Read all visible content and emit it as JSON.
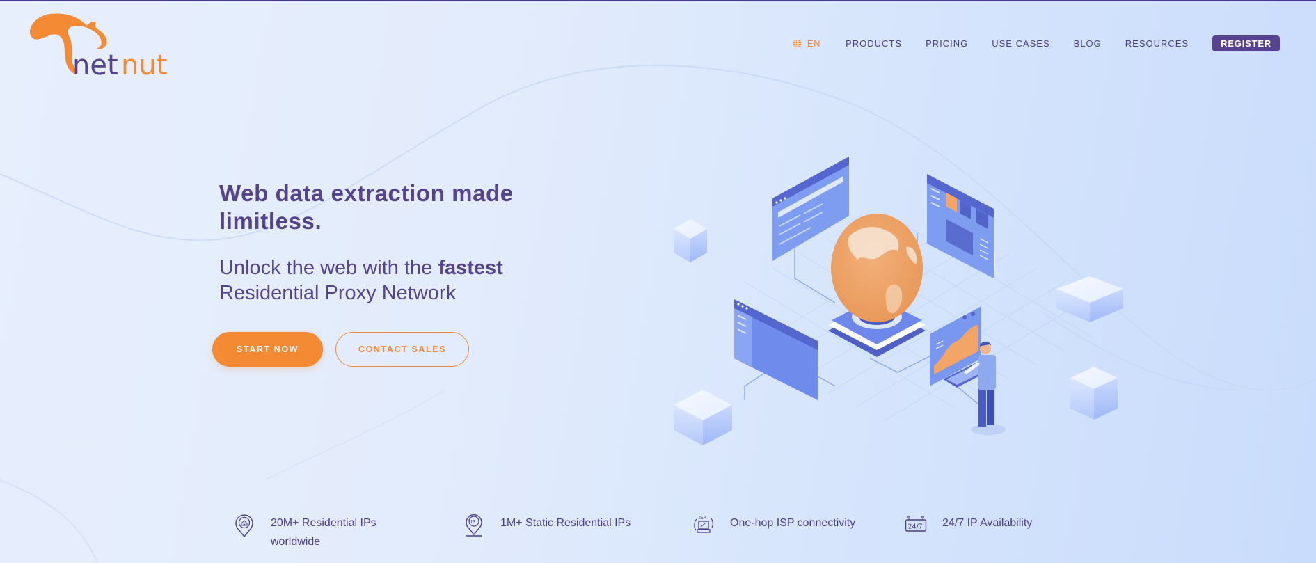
{
  "brand": {
    "logo_text_part1": "net",
    "logo_text_part2": "nut",
    "colors": {
      "primary_purple": "#56438f",
      "accent_orange": "#f58a35",
      "background": "#dde8fc"
    }
  },
  "nav": {
    "language": {
      "icon": "globe-icon",
      "label": "EN"
    },
    "items": [
      {
        "label": "PRODUCTS"
      },
      {
        "label": "PRICING"
      },
      {
        "label": "USE CASES"
      },
      {
        "label": "BLOG"
      },
      {
        "label": "RESOURCES"
      }
    ],
    "register_label": "REGISTER"
  },
  "hero": {
    "title": "Web data extraction made limitless.",
    "subtitle_prefix": "Unlock the web with the ",
    "subtitle_bold": "fastest",
    "subtitle_suffix": " Residential Proxy Network",
    "start_label": "START NOW",
    "contact_label": "CONTACT SALES",
    "illustration": "isometric-globe-network-illustration"
  },
  "features": [
    {
      "icon": "residential-location-pin-icon",
      "text": "20M+ Residential IPs worldwide"
    },
    {
      "icon": "ip-location-pin-icon",
      "text": "1M+ Static Residential IPs"
    },
    {
      "icon": "isp-laptop-icon",
      "text": "One-hop ISP connectivity"
    },
    {
      "icon": "24-7-calendar-icon",
      "text": "24/7 IP Availability"
    }
  ]
}
